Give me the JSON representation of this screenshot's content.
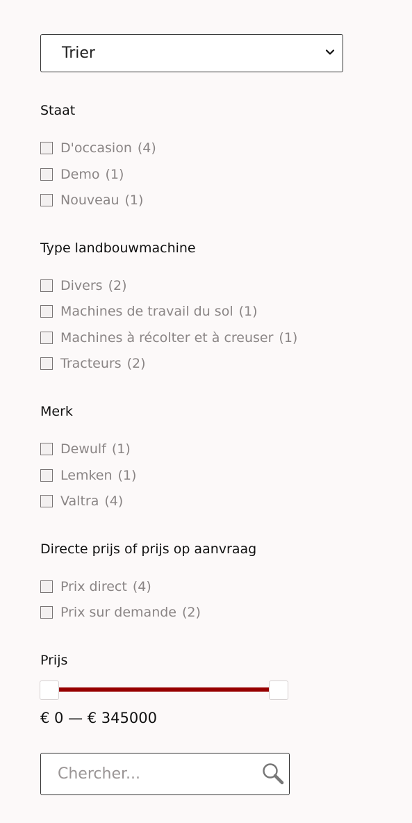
{
  "sort": {
    "label": "Trier"
  },
  "groups": [
    {
      "title": "Staat",
      "options": [
        {
          "label": "D'occasion",
          "count": "(4)"
        },
        {
          "label": "Demo",
          "count": "(1)"
        },
        {
          "label": "Nouveau",
          "count": "(1)"
        }
      ]
    },
    {
      "title": "Type landbouwmachine",
      "options": [
        {
          "label": "Divers",
          "count": "(2)"
        },
        {
          "label": "Machines de travail du sol",
          "count": "(1)"
        },
        {
          "label": "Machines à récolter et à creuser",
          "count": "(1)"
        },
        {
          "label": "Tracteurs",
          "count": "(2)"
        }
      ]
    },
    {
      "title": "Merk",
      "options": [
        {
          "label": "Dewulf",
          "count": "(1)"
        },
        {
          "label": "Lemken",
          "count": "(1)"
        },
        {
          "label": "Valtra",
          "count": "(4)"
        }
      ]
    },
    {
      "title": "Directe prijs of prijs op aanvraag",
      "options": [
        {
          "label": "Prix direct",
          "count": "(4)"
        },
        {
          "label": "Prix sur demande",
          "count": "(2)"
        }
      ]
    }
  ],
  "price": {
    "title": "Prijs",
    "range_text": "€ 0 — € 345000",
    "min": 0,
    "max": 345000,
    "selected_min": 0,
    "selected_max": 345000,
    "track_color": "#960000"
  },
  "search": {
    "placeholder": "Chercher..."
  }
}
